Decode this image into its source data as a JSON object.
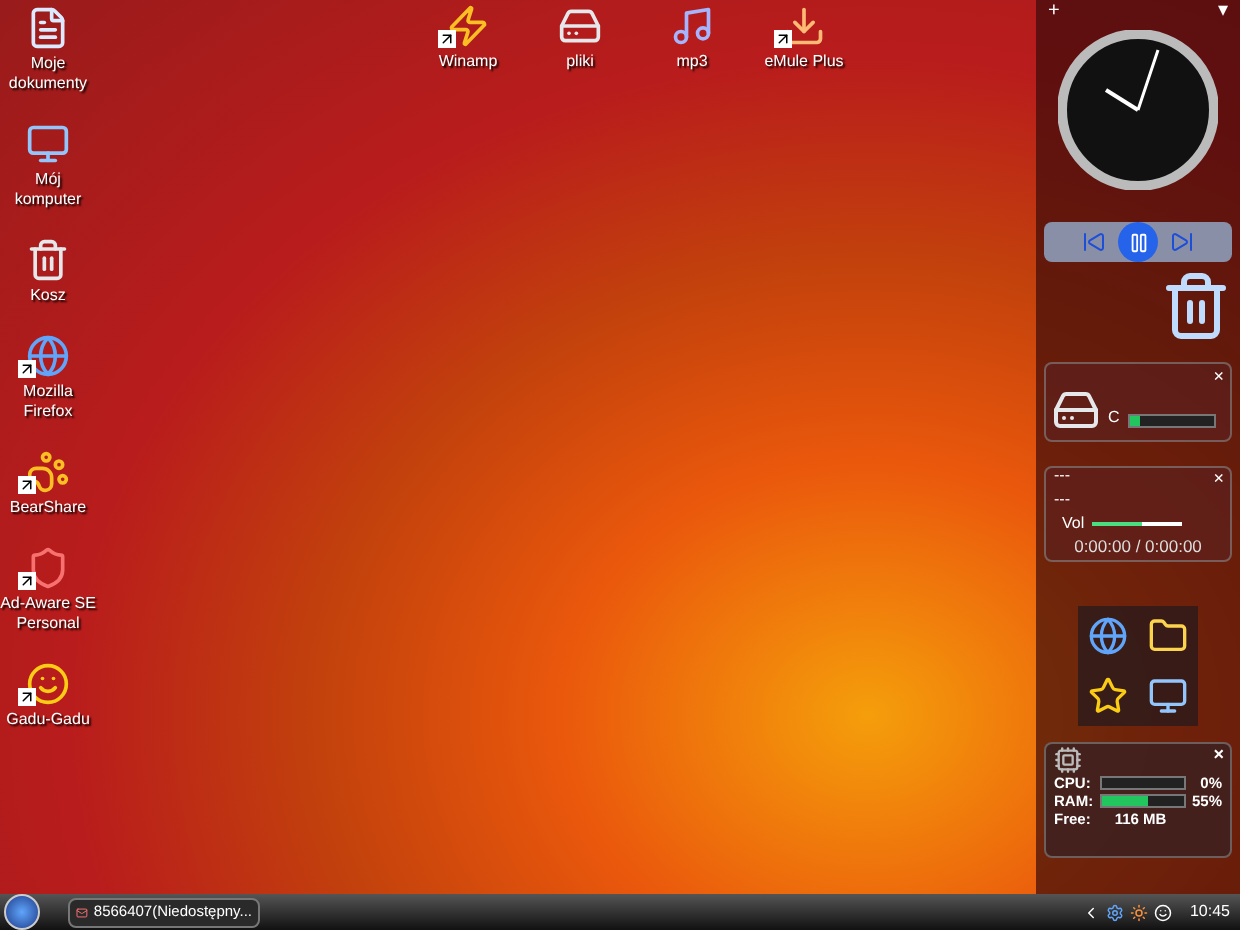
{
  "desktop_icons": [
    {
      "label": "Moje dokumenty",
      "kind": "documents",
      "shortcut": false
    },
    {
      "label": "Mój komputer",
      "kind": "computer",
      "shortcut": false
    },
    {
      "label": "Kosz",
      "kind": "trash",
      "shortcut": false
    },
    {
      "label": "Mozilla Firefox",
      "kind": "browser",
      "shortcut": true
    },
    {
      "label": "BearShare",
      "kind": "bear",
      "shortcut": true
    },
    {
      "label": "Ad-Aware SE Personal",
      "kind": "shield",
      "shortcut": true
    },
    {
      "label": "Gadu-Gadu",
      "kind": "smile",
      "shortcut": true
    }
  ],
  "top_icons": [
    {
      "label": "Winamp",
      "kind": "player",
      "shortcut": true
    },
    {
      "label": "pliki",
      "kind": "drive",
      "shortcut": false
    },
    {
      "label": "mp3",
      "kind": "music",
      "shortcut": false
    },
    {
      "label": "eMule Plus",
      "kind": "download",
      "shortcut": true
    }
  ],
  "sidebar": {
    "add_symbol": "+",
    "menu_symbol": "▾",
    "drive": {
      "label": "C",
      "level": 0.12,
      "close": "×"
    },
    "media": {
      "line_1": "---",
      "line_2": "---",
      "volume_label": "Vol",
      "level": 0.55,
      "time": "0:00:00 / 0:00:00",
      "close": "×"
    },
    "launcher": [
      {
        "kind": "browser"
      },
      {
        "kind": "folder"
      },
      {
        "kind": "star"
      },
      {
        "kind": "computer"
      }
    ],
    "monitor": {
      "close": "×",
      "rows": [
        {
          "label": "CPU:",
          "level": 0,
          "value": "0%"
        },
        {
          "label": "RAM:",
          "level": 0.55,
          "value": "55%"
        }
      ],
      "free_label": "Free:",
      "free_value": "116 MB"
    }
  },
  "taskbar": {
    "tasks": [
      {
        "label": "8566407(Niedostępny...",
        "selected": false
      }
    ],
    "clock": "10:45"
  }
}
